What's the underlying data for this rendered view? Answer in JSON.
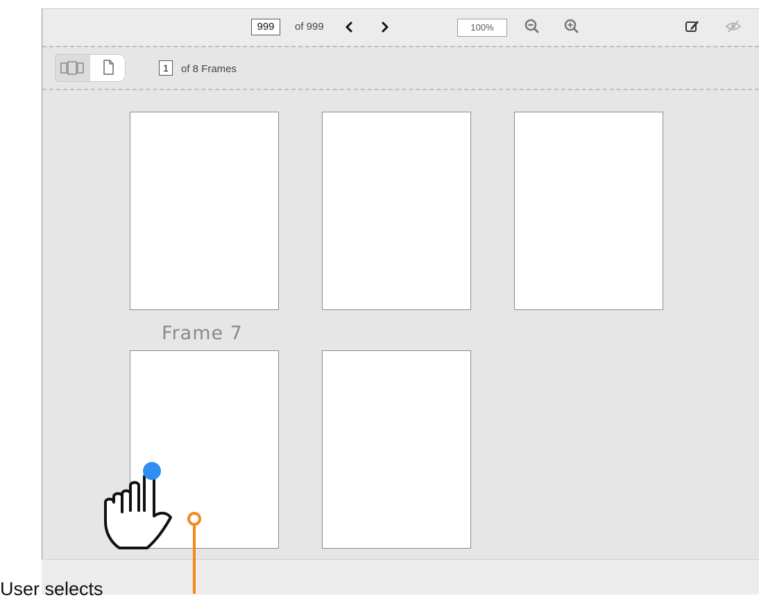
{
  "toolbar": {
    "page_current": "999",
    "page_of": "of 999",
    "zoom": "100%",
    "icons": [
      "chevron-left-icon",
      "chevron-right-icon",
      "zoom-out-icon",
      "zoom-in-icon",
      "edit-icon",
      "hide-icon"
    ]
  },
  "subtoolbar": {
    "frame_current": "1",
    "frame_of": "of 8 Frames",
    "view_modes": [
      "filmstrip-view-icon",
      "single-page-view-icon"
    ]
  },
  "frames": {
    "hover_label": "Frame 7"
  },
  "annotation": {
    "caption": "User selects",
    "accent_color": "#f28a1c",
    "touch_color": "#2e8ff0"
  }
}
